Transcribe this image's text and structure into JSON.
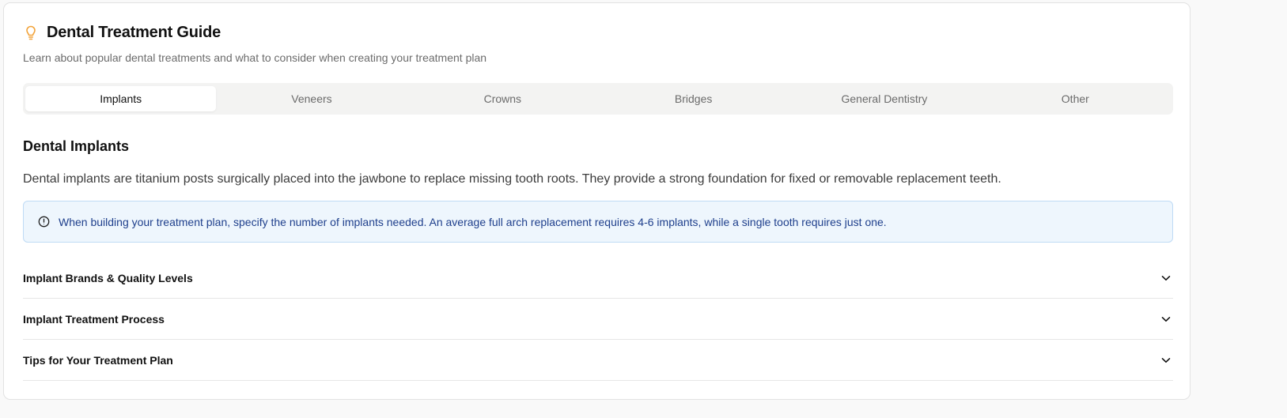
{
  "header": {
    "icon": "lightbulb-icon",
    "icon_color": "#f2a33a",
    "title": "Dental Treatment Guide",
    "subtitle": "Learn about popular dental treatments and what to consider when creating your treatment plan"
  },
  "tabs": [
    {
      "label": "Implants",
      "active": true
    },
    {
      "label": "Veneers",
      "active": false
    },
    {
      "label": "Crowns",
      "active": false
    },
    {
      "label": "Bridges",
      "active": false
    },
    {
      "label": "General Dentistry",
      "active": false
    },
    {
      "label": "Other",
      "active": false
    }
  ],
  "content": {
    "section_title": "Dental Implants",
    "description": "Dental implants are titanium posts surgically placed into the jawbone to replace missing tooth roots. They provide a strong foundation for fixed or removable replacement teeth.",
    "alert": {
      "icon": "info-circle-icon",
      "text": "When building your treatment plan, specify the number of implants needed. An average full arch replacement requires 4-6 implants, while a single tooth requires just one."
    },
    "accordion": [
      {
        "label": "Implant Brands & Quality Levels",
        "icon": "chevron-down-icon"
      },
      {
        "label": "Implant Treatment Process",
        "icon": "chevron-down-icon"
      },
      {
        "label": "Tips for Your Treatment Plan",
        "icon": "chevron-down-icon"
      }
    ]
  },
  "colors": {
    "accent": "#f2a33a",
    "alert_bg": "#eef6fd",
    "alert_text": "#1e3f8c"
  }
}
